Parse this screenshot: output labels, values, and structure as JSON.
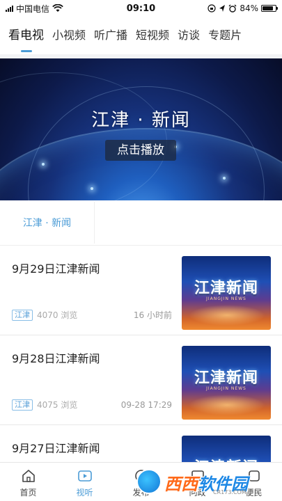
{
  "status_bar": {
    "carrier": "中国电信",
    "time": "09:10",
    "battery": "84%",
    "battery_level": 0.84
  },
  "top_tabs": [
    {
      "label": "看电视",
      "active": true
    },
    {
      "label": "小视频",
      "active": false
    },
    {
      "label": "听广播",
      "active": false
    },
    {
      "label": "短视频",
      "active": false
    },
    {
      "label": "访谈",
      "active": false
    },
    {
      "label": "专题片",
      "active": false
    }
  ],
  "banner": {
    "title": "江津 · 新闻",
    "play_label": "点击播放"
  },
  "section": {
    "tag": "江津 · 新闻"
  },
  "news": [
    {
      "title": "9月29日江津新闻",
      "tag": "江津",
      "views": "4070 浏览",
      "time": "16 小时前",
      "thumb_text": "江津新闻",
      "thumb_sub": "JIANGJIN NEWS"
    },
    {
      "title": "9月28日江津新闻",
      "tag": "江津",
      "views": "4075 浏览",
      "time": "09-28 17:29",
      "thumb_text": "江津新闻",
      "thumb_sub": "JIANGJIN NEWS"
    },
    {
      "title": "9月27日江津新闻",
      "tag": "",
      "views": "",
      "time": "",
      "thumb_text": "江津新闻",
      "thumb_sub": ""
    }
  ],
  "bottom_nav": [
    {
      "label": "首页",
      "icon": "home-icon",
      "active": false
    },
    {
      "label": "视听",
      "icon": "tv-icon",
      "active": true
    },
    {
      "label": "发布",
      "icon": "publish-icon",
      "active": false
    },
    {
      "label": "问政",
      "icon": "question-icon",
      "active": false
    },
    {
      "label": "便民",
      "icon": "service-icon",
      "active": false
    }
  ],
  "watermark": {
    "brand_main": "西西",
    "brand_rest": "软件园",
    "url": "CR173.COM"
  },
  "colors": {
    "accent": "#4a9bd6",
    "divider": "#eeeeee"
  }
}
